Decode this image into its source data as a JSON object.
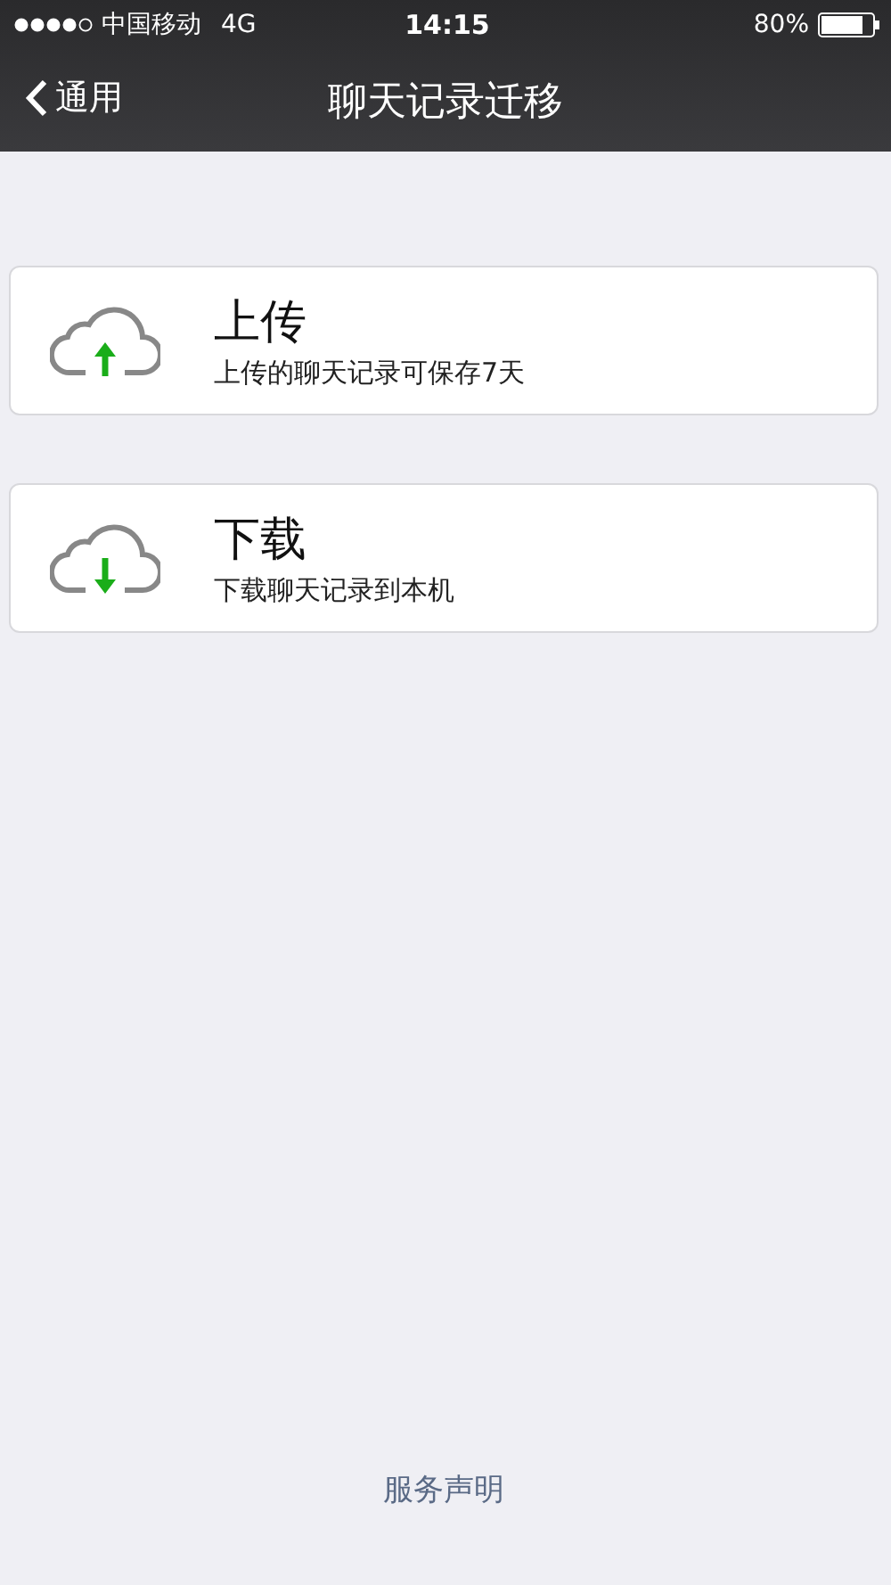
{
  "status_bar": {
    "carrier": "中国移动",
    "network": "4G",
    "time": "14:15",
    "battery": "80%"
  },
  "nav": {
    "back": "通用",
    "title": "聊天记录迁移"
  },
  "items": [
    {
      "kind": "upload",
      "title": "上传",
      "subtitle": "上传的聊天记录可保存7天"
    },
    {
      "kind": "download",
      "title": "下载",
      "subtitle": "下载聊天记录到本机"
    }
  ],
  "footer_link": "服务声明"
}
